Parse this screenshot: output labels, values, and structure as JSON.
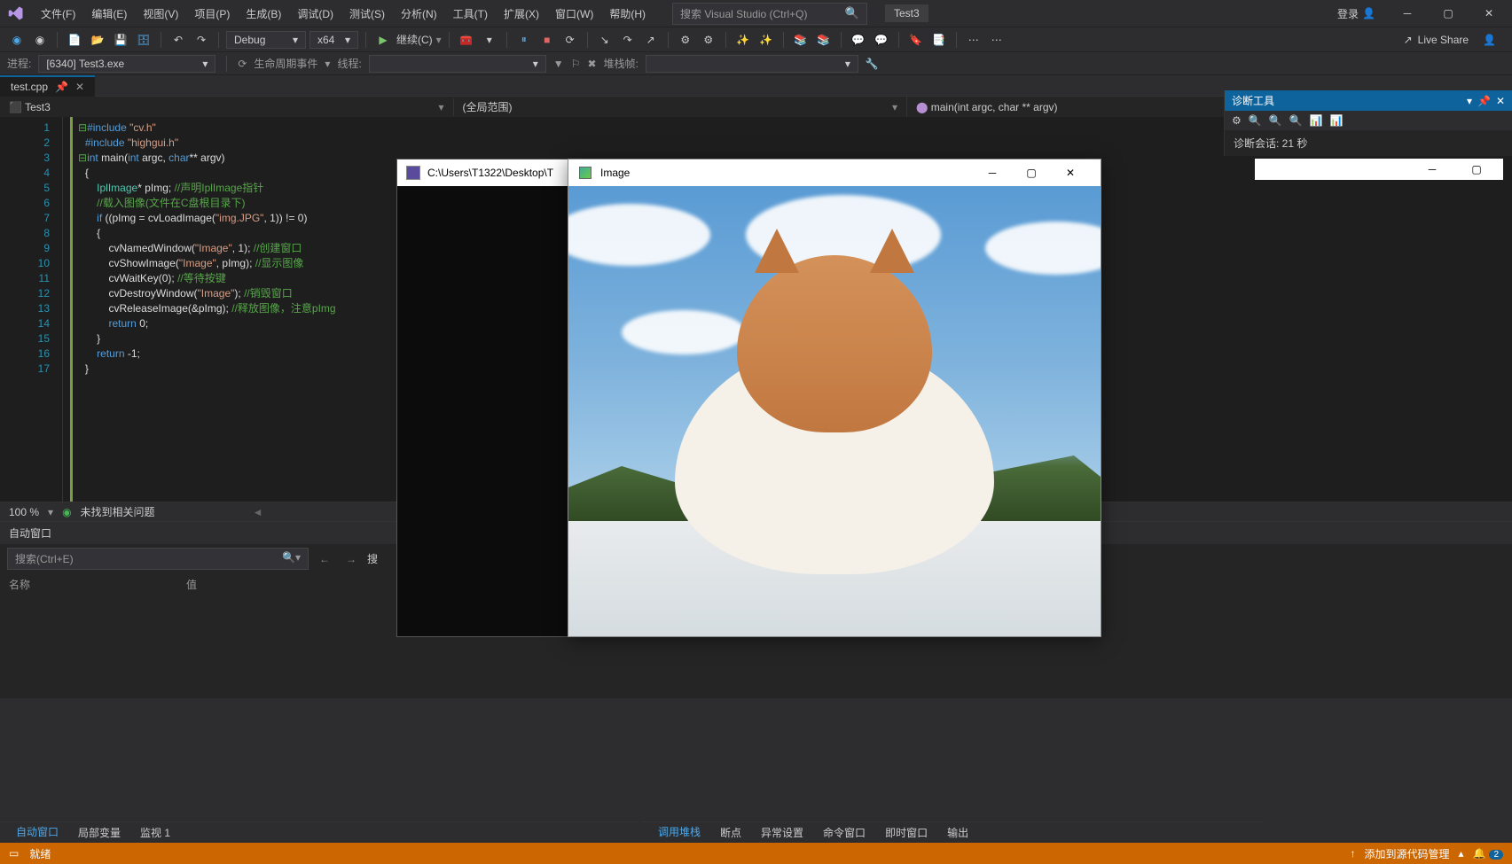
{
  "menu": {
    "file": "文件(F)",
    "edit": "编辑(E)",
    "view": "视图(V)",
    "project": "项目(P)",
    "build": "生成(B)",
    "debug": "调试(D)",
    "test": "测试(S)",
    "analyze": "分析(N)",
    "tools": "工具(T)",
    "extensions": "扩展(X)",
    "window": "窗口(W)",
    "help": "帮助(H)"
  },
  "search": {
    "placeholder": "搜索 Visual Studio (Ctrl+Q)"
  },
  "title": "Test3",
  "login": "登录",
  "toolbar": {
    "config": "Debug",
    "platform": "x64",
    "continue": "继续(C)"
  },
  "process": {
    "label": "进程:",
    "value": "[6340] Test3.exe",
    "lifecycle": "生命周期事件",
    "thread": "线程:",
    "stack": "堆栈帧:"
  },
  "tab": {
    "filename": "test.cpp"
  },
  "nav": {
    "project": "Test3",
    "scope": "(全局范围)",
    "func": "main(int argc, char ** argv)"
  },
  "lines": [
    "1",
    "2",
    "3",
    "4",
    "5",
    "6",
    "7",
    "8",
    "9",
    "10",
    "11",
    "12",
    "13",
    "14",
    "15",
    "16",
    "17"
  ],
  "zoom": "100 %",
  "noissues": "未找到相关问题",
  "auto_panel": {
    "title": "自动窗口",
    "search_placeholder": "搜索(Ctrl+E)",
    "col_name": "名称",
    "col_value": "值",
    "depth": "搜"
  },
  "bottom_left": {
    "auto": "自动窗口",
    "locals": "局部变量",
    "watch": "监视 1"
  },
  "bottom_right": {
    "callstack": "调用堆栈",
    "breakpoints": "断点",
    "exceptions": "异常设置",
    "command": "命令窗口",
    "immediate": "即时窗口",
    "output": "输出"
  },
  "status": {
    "ready": "就绪",
    "scm": "添加到源代码管理",
    "notif_count": "2"
  },
  "diag": {
    "title": "诊断工具",
    "session": "诊断会话: 21 秒"
  },
  "live_share": "Live Share",
  "console": {
    "path": "C:\\Users\\T1322\\Desktop\\T"
  },
  "image_win": {
    "title": "Image"
  },
  "code": {
    "l1a": "#include ",
    "l1b": "\"cv.h\"",
    "l2a": "#include ",
    "l2b": "\"highgui.h\"",
    "l3a": "int",
    "l3b": " main(",
    "l3c": "int",
    "l3d": " argc, ",
    "l3e": "char",
    "l3f": "** argv)",
    "l4": "{",
    "l5a": "    IplImage",
    "l5b": "* pImg; ",
    "l5c": "//声明IplImage指针",
    "l6": "    //载入图像(文件在C盘根目录下)",
    "l7a": "    if",
    "l7b": " ((pImg = cvLoadImage(",
    "l7c": "\"img.JPG\"",
    "l7d": ", 1)) != 0)",
    "l8": "    {",
    "l9a": "        cvNamedWindow(",
    "l9b": "\"Image\"",
    "l9c": ", 1); ",
    "l9d": "//创建窗口",
    "l10a": "        cvShowImage(",
    "l10b": "\"Image\"",
    "l10c": ", pImg); ",
    "l10d": "//显示图像",
    "l11a": "        cvWaitKey(0); ",
    "l11b": "//等待按键",
    "l12a": "        cvDestroyWindow(",
    "l12b": "\"Image\"",
    "l12c": "); ",
    "l12d": "//销毁窗口",
    "l13a": "        cvReleaseImage(&pImg); ",
    "l13b": "//释放图像，注意pImg",
    "l14a": "        return",
    "l14b": " 0;",
    "l15": "    }",
    "l16a": "    return",
    "l16b": " -1;",
    "l17": "}"
  }
}
